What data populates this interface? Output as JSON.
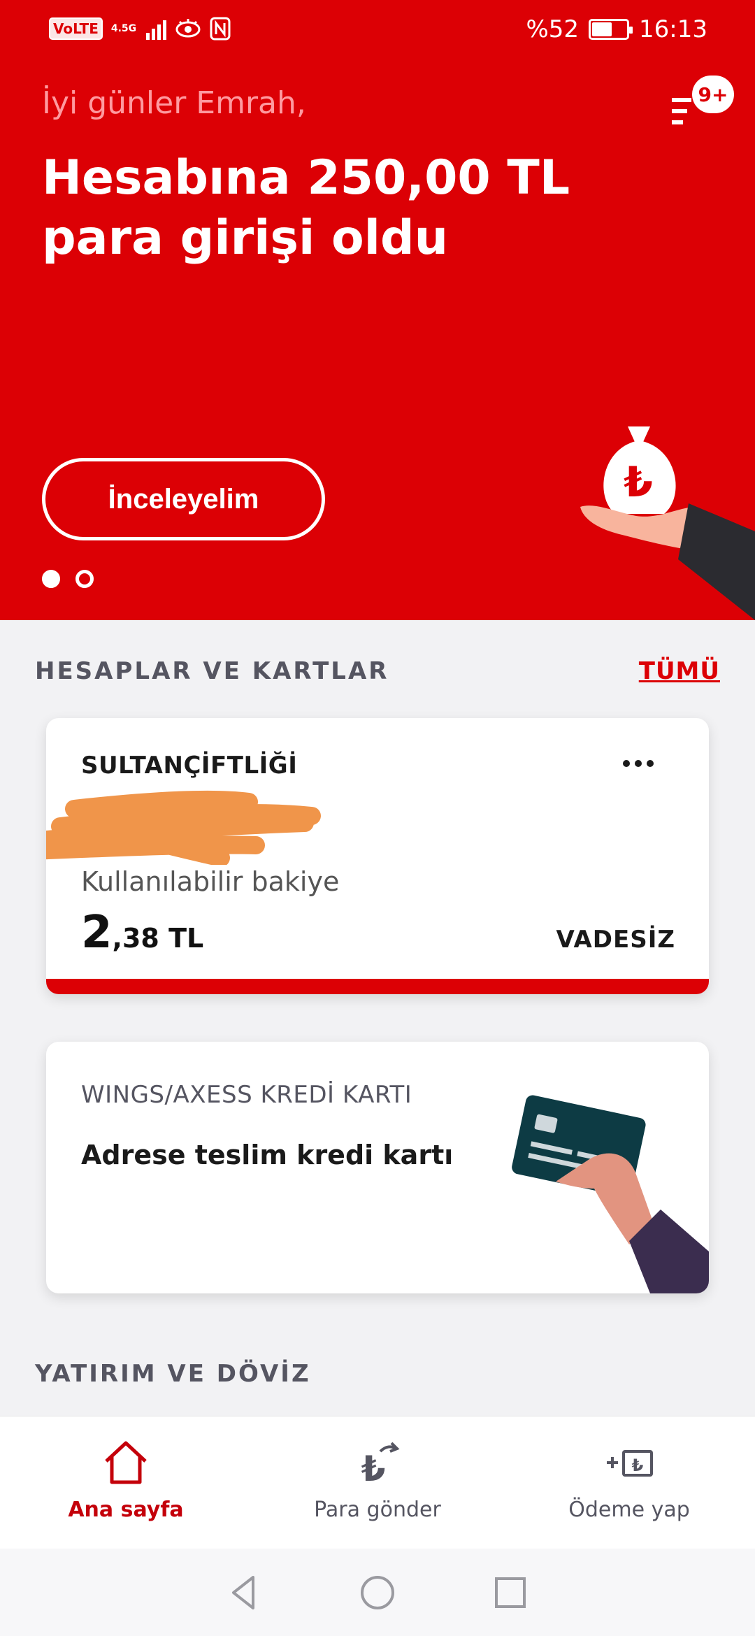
{
  "status_bar": {
    "volte": "VoLTE",
    "network": "4.5G",
    "battery": "%52",
    "time": "16:13"
  },
  "hero": {
    "greeting": "İyi günler Emrah,",
    "title": "Hesabına 250,00 TL para girişi oldu",
    "button_label": "İnceleyelim",
    "badge": "9+"
  },
  "accounts": {
    "section_title": "HESAPLAR VE KARTLAR",
    "see_all": "TÜMÜ",
    "account": {
      "name": "SULTANÇİFTLİĞİ",
      "available_label": "Kullanılabilir bakiye",
      "balance_int": "2",
      "balance_dec": ",38 TL",
      "type": "VADESİZ"
    },
    "credit_card": {
      "label": "WINGS/AXESS KREDİ KARTI",
      "description": "Adrese teslim kredi kartı"
    }
  },
  "investment": {
    "section_title": "YATIRIM VE DÖVİZ"
  },
  "bottom_nav": [
    {
      "label": "Ana sayfa",
      "icon": "home-icon",
      "active": true
    },
    {
      "label": "Para gönder",
      "icon": "send-money-icon",
      "active": false
    },
    {
      "label": "Ödeme yap",
      "icon": "payment-icon",
      "active": false
    }
  ],
  "colors": {
    "brand_red": "#dc0005",
    "text_dark": "#1a1a1a",
    "text_muted": "#555561"
  }
}
